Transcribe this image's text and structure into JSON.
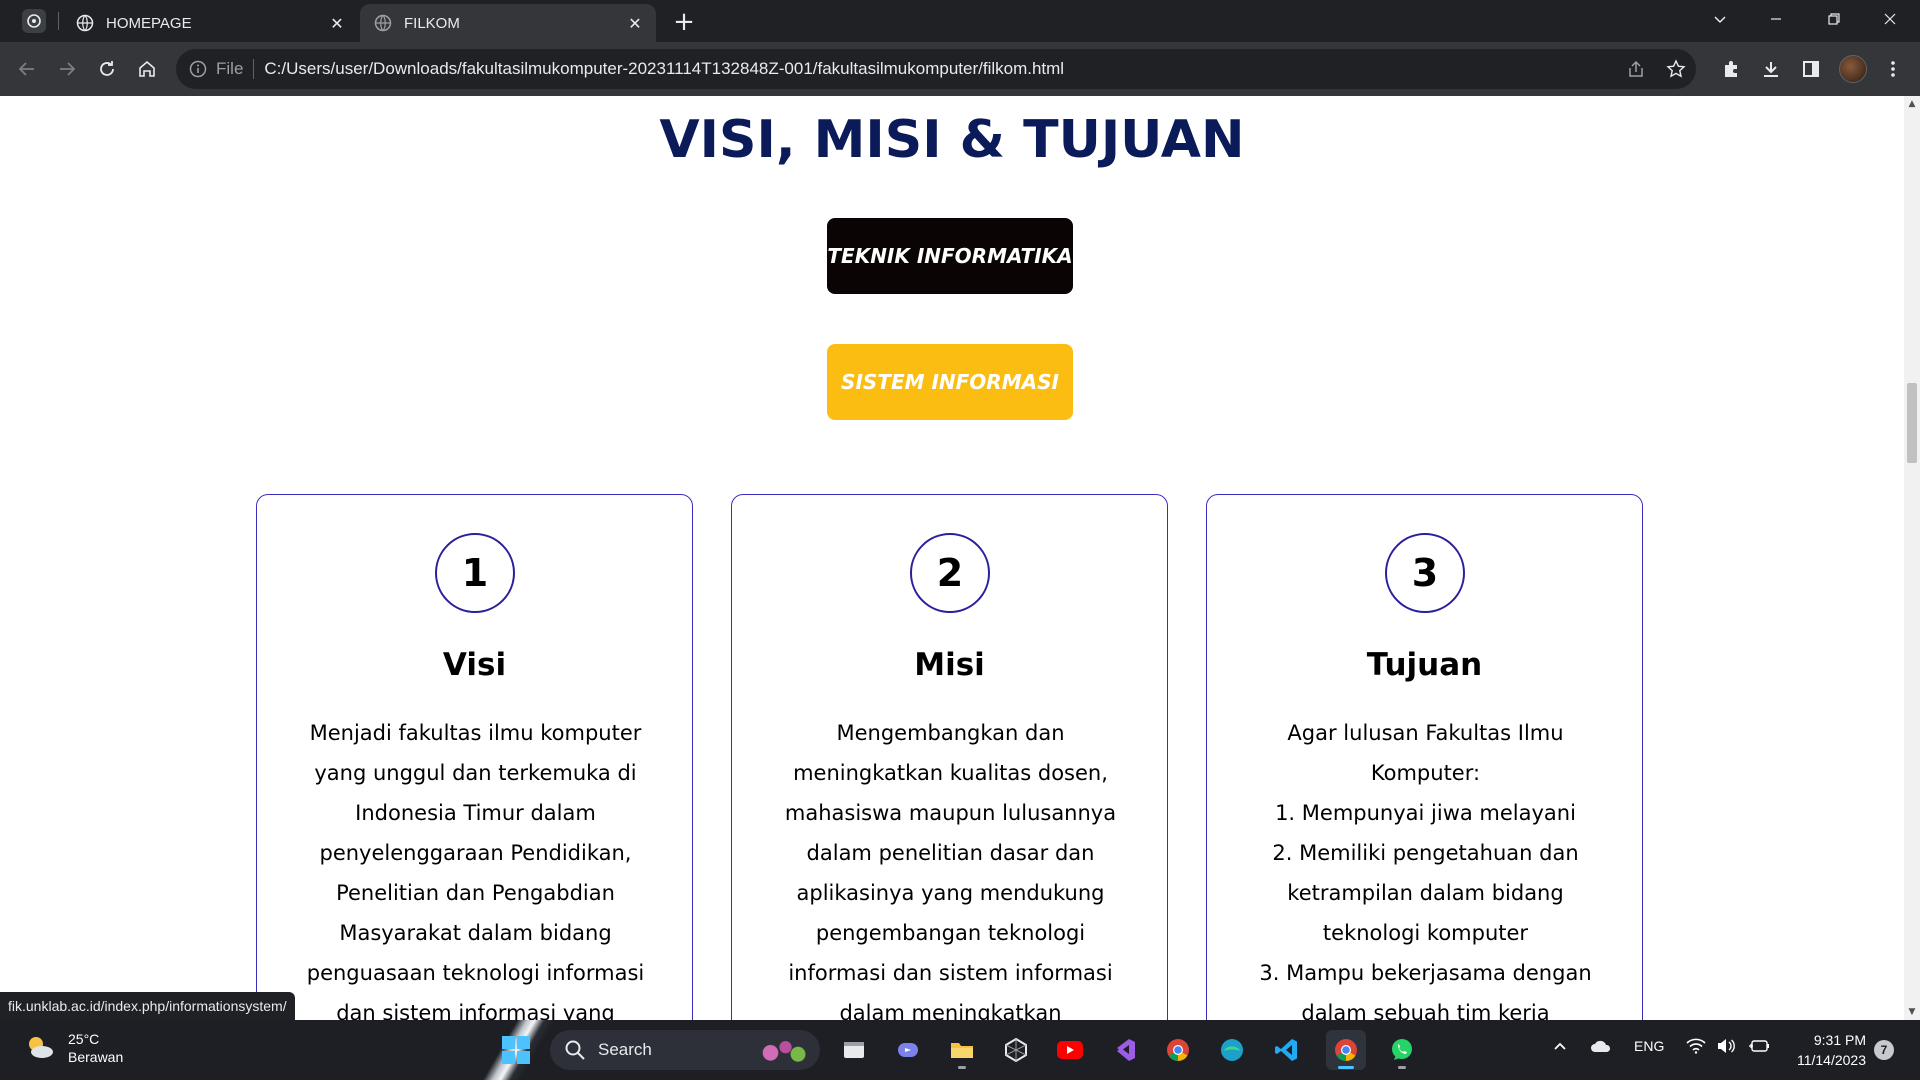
{
  "browser": {
    "tabs": [
      {
        "title": "HOMEPAGE",
        "active": false
      },
      {
        "title": "FILKOM",
        "active": true
      }
    ],
    "omnibox": {
      "scheme_label": "File",
      "url": "C:/Users/user/Downloads/fakultasilmukomputer-20231114T132848Z-001/fakultasilmukomputer/filkom.html"
    },
    "status_url": "fik.unklab.ac.id/index.php/informationsystem/"
  },
  "page": {
    "title": "VISI, MISI & TUJUAN",
    "program_buttons": {
      "teknik_informatika": "TEKNIK INFORMATIKA",
      "sistem_informasi": "SISTEM INFORMASI"
    },
    "cards": [
      {
        "number": "1",
        "title": "Visi",
        "lines": [
          "Menjadi fakultas ilmu komputer",
          "yang unggul dan terkemuka di",
          "Indonesia Timur dalam",
          "penyelenggaraan Pendidikan,",
          "Penelitian dan Pengabdian",
          "Masyarakat dalam bidang",
          "penguasaan teknologi informasi",
          "dan sistem informasi yang"
        ]
      },
      {
        "number": "2",
        "title": "Misi",
        "lines": [
          "Mengembangkan dan",
          "meningkatkan kualitas dosen,",
          "mahasiswa maupun lulusannya",
          "dalam penelitian dasar dan",
          "aplikasinya yang mendukung",
          "pengembangan teknologi",
          "informasi dan sistem informasi",
          "dalam meningkatkan"
        ]
      },
      {
        "number": "3",
        "title": "Tujuan",
        "lines": [
          "Agar lulusan Fakultas Ilmu",
          "Komputer:",
          "1. Mempunyai jiwa melayani",
          "2. Memiliki pengetahuan dan",
          "ketrampilan dalam bidang",
          "teknologi komputer",
          "3. Mampu bekerjasama dengan",
          "dalam sebuah tim kerja"
        ]
      }
    ],
    "colors": {
      "title": "#0b1a59",
      "card_border": "#3a2dbf",
      "teknik_informatika_bg": "#0a0404",
      "sistem_informasi_bg": "#fbbd12"
    }
  },
  "taskbar": {
    "weather": {
      "temp": "25°C",
      "condition": "Berawan"
    },
    "search_label": "Search",
    "apps": [
      "file-explorer-icon",
      "teams-icon",
      "folder-icon",
      "unity-icon",
      "youtube-icon",
      "visual-studio-icon",
      "chrome-icon",
      "edge-icon",
      "vscode-icon",
      "chrome-profile-icon",
      "whatsapp-icon"
    ],
    "language": "ENG",
    "time": "9:31 PM",
    "date": "11/14/2023",
    "notification_count": "7"
  }
}
